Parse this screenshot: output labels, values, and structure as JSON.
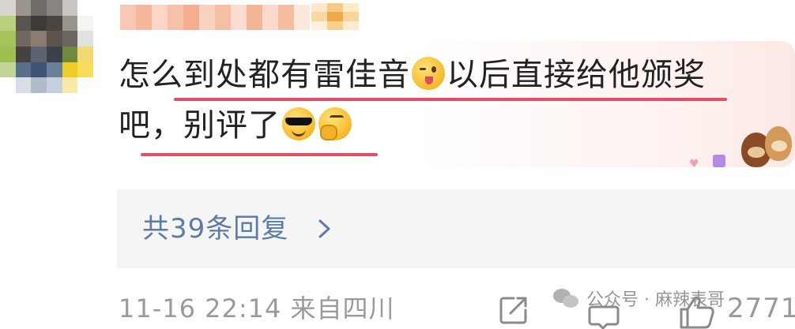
{
  "comment": {
    "line1_part1": "怎么到处都有雷佳音",
    "line1_part2": "以后直接给他颁奖",
    "line2": "吧，别评了",
    "emojis": [
      "wink-tongue-emoji",
      "sunglasses-emoji",
      "thinking-emoji"
    ]
  },
  "replies": {
    "label": "共39条回复"
  },
  "meta": {
    "timestamp_location": "11-16 22:14 来自四川"
  },
  "actions": {
    "like_count": "2771"
  },
  "watermark": {
    "text": "公众号 · 麻辣表哥"
  },
  "colors": {
    "underline": "#e64c62",
    "link": "#5c7ba8",
    "meta_gray": "#9a9a9a",
    "reply_bg": "#f5f5f5"
  }
}
